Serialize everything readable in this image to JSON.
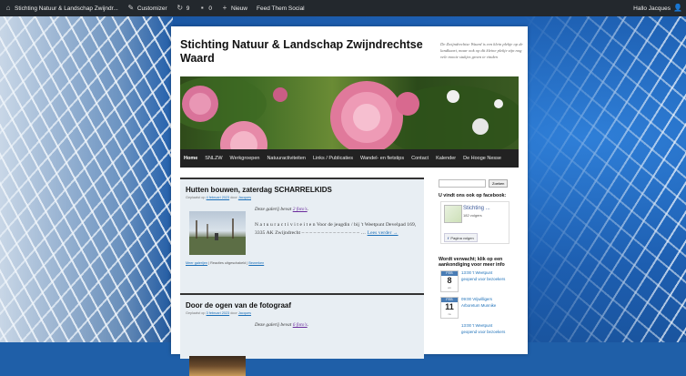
{
  "adminbar": {
    "site": "Stichting Natuur & Landschap Zwijndr...",
    "customize": "Customizer",
    "updates": "9",
    "comments": "0",
    "new": "Nieuw",
    "feedthem": "Feed Them Social",
    "greeting": "Hallo Jacques"
  },
  "site": {
    "title": "Stichting Natuur & Landschap Zwijndrechtse Waard",
    "description": "De Zwijndrechtse Waard is een klein plekje op de landkaart, maar ook op dit kleine plekje zijn nog vele mooie stukjes groen te vinden"
  },
  "nav": [
    "Home",
    "SNLZW",
    "Werkgroepen",
    "Natuuractiviteiten",
    "Links / Publicaties",
    "Wandel- en fietstips",
    "Contact",
    "Kalender",
    "De Hooge Nesse"
  ],
  "posts": [
    {
      "title": "Hutten bouwen, zaterdag SCHARRELKIDS",
      "meta_prefix": "Geplaatst op ",
      "date": "4 februari 2023",
      "meta_mid": " door ",
      "author": "Jacques",
      "gallery_prefix": "Deze galerij bevat ",
      "gallery_link": "2 foto's",
      "gallery_suffix": ".",
      "excerpt": "N a t u u r a c t i v i t e i t e n Voor de jeugdin / bij 't Weetpunt Develpad 169, 3335 AK Zwijndrecht – – – – – – – – – – – – – – – …",
      "read_more": "Lees verder →",
      "footer_more": "Meer galerijen",
      "footer_sep1": " | Reacties uitgeschakeld | ",
      "footer_edit": "Bewerken"
    },
    {
      "title": "Door de ogen van de fotograaf",
      "meta_prefix": "Geplaatst op ",
      "date": "3 februari 2023",
      "meta_mid": " door ",
      "author": "Jacques",
      "gallery_prefix": "Deze galerij bevat ",
      "gallery_link": "6 foto's",
      "gallery_suffix": "."
    }
  ],
  "sidebar": {
    "search_button": "Zoeken",
    "fb_title": "U vindt ons ook op facebook:",
    "fb_name": "Stichting ...",
    "fb_likes": "182 volgers",
    "fb_button": "Pagina volgen",
    "agenda_title": "Wordt verwacht; klik op een aankondiging voor meer info",
    "events": [
      {
        "month": "FEB",
        "day": "8",
        "dow": "wo",
        "text": "13:00 't Weetpunt geopend voor bezoekers"
      },
      {
        "month": "FEB",
        "day": "11",
        "dow": "za",
        "text": "09:00 Vrijwilligers Arboretum Munnike"
      },
      {
        "month": "",
        "day": "",
        "dow": "",
        "text": "13:00 't Weetpunt geopend voor bezoekers"
      }
    ]
  },
  "colors": {
    "adminbar": "#23282d",
    "nav": "#222222",
    "link": "#1b6fb8",
    "post_bg": "#e8eef3"
  }
}
